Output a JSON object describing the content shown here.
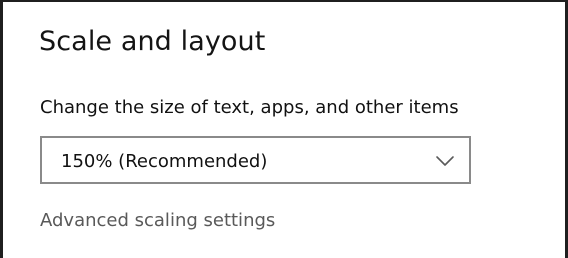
{
  "section": {
    "title": "Scale and layout"
  },
  "scaling": {
    "label": "Change the size of text, apps, and other items",
    "selected": "150% (Recommended)",
    "chevron_icon": "chevron-down-icon"
  },
  "links": {
    "advanced": "Advanced scaling settings"
  },
  "colors": {
    "frame": "#1f1f1f",
    "dropdown_border": "#8a8a8a",
    "link_text": "#595959"
  }
}
